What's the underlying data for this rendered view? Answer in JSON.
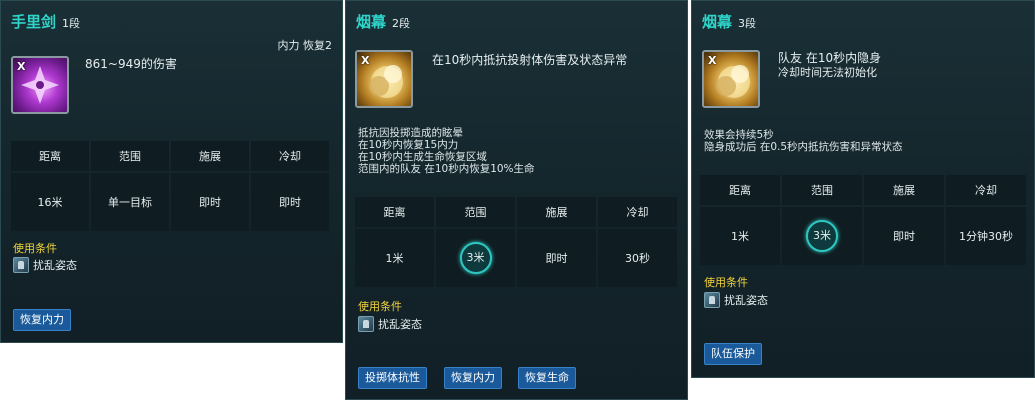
{
  "panels": [
    {
      "title": "手里剑",
      "rank": "1段",
      "cost": "内力 恢复2",
      "icon": "shuriken-icon",
      "icon_key": "X",
      "description": [
        "861~949的伤害"
      ],
      "effects": [],
      "headers": [
        "距离",
        "范围",
        "施展",
        "冷却"
      ],
      "values": [
        "16米",
        "单一目标",
        "即时",
        "即时"
      ],
      "condition_label": "使用条件",
      "condition_item": "扰乱姿态",
      "tags": [
        "恢复内力"
      ]
    },
    {
      "title": "烟幕",
      "rank": "2段",
      "cost": "",
      "icon": "smoke-bomb-icon",
      "icon_key": "X",
      "description": [
        "在10秒内抵抗投射体伤害及状态异常"
      ],
      "effects": [
        "抵抗因投掷造成的眩晕",
        "在10秒内恢复15内力",
        "在10秒内生成生命恢复区域",
        "范围内的队友 在10秒内恢复10%生命"
      ],
      "headers": [
        "距离",
        "范围",
        "施展",
        "冷却"
      ],
      "values": [
        "1米",
        "3米",
        "即时",
        "30秒"
      ],
      "condition_label": "使用条件",
      "condition_item": "扰乱姿态",
      "tags": [
        "投掷体抗性",
        "恢复内力",
        "恢复生命"
      ]
    },
    {
      "title": "烟幕",
      "rank": "3段",
      "cost": "",
      "icon": "smoke-bomb-icon",
      "icon_key": "X",
      "description": [
        "队友 在10秒内隐身",
        "冷却时间无法初始化"
      ],
      "effects": [
        "效果会持续5秒",
        "隐身成功后 在0.5秒内抵抗伤害和异常状态"
      ],
      "headers": [
        "距离",
        "范围",
        "施展",
        "冷却"
      ],
      "values": [
        "1米",
        "3米",
        "即时",
        "1分钟30秒"
      ],
      "condition_label": "使用条件",
      "condition_item": "扰乱姿态",
      "tags": [
        "队伍保护"
      ]
    }
  ]
}
